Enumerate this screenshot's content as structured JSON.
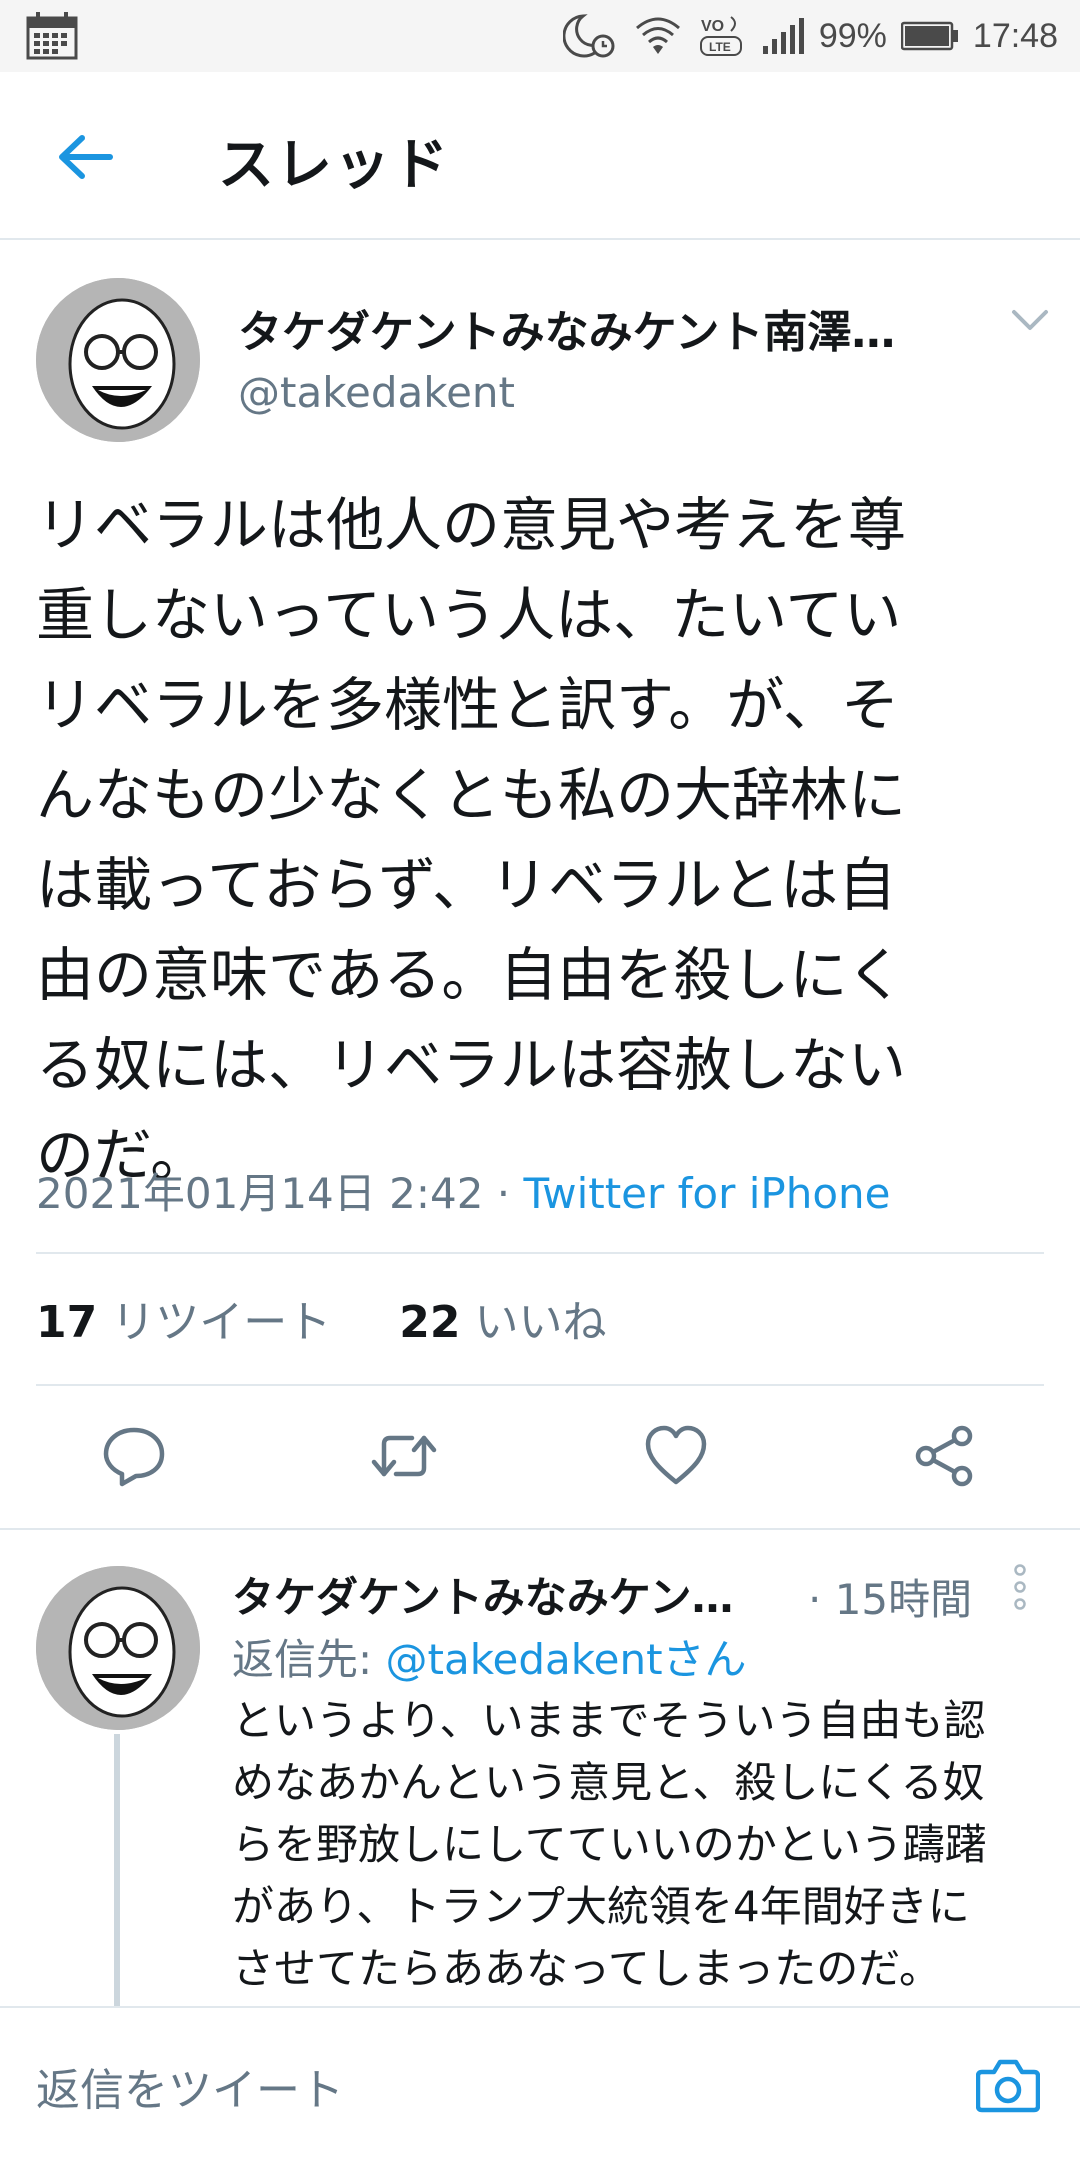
{
  "status_bar": {
    "battery_percent": "99%",
    "time": "17:48",
    "volte_label": "VoLTE",
    "icons": [
      "calendar-icon",
      "alarm-moon-icon",
      "wifi-icon",
      "volte-icon",
      "signal-icon",
      "battery-icon"
    ]
  },
  "header": {
    "title": "スレッド",
    "back_icon": "arrow-left-icon"
  },
  "main_tweet": {
    "author_name": "タケダケントみなみケント南澤径…",
    "handle": "@takedakent",
    "text": "リベラルは他人の意見や考えを尊\n重しないっていう人は、たいてい\nリベラルを多様性と訳す。が、そ\nんなもの少なくとも私の大辞林に\nは載っておらず、リベラルとは自\n由の意味である。自由を殺しにく\nる奴には、リベラルは容赦しない\nのだ。",
    "timestamp": "2021年01月14日 2:42",
    "separator": " · ",
    "source": "Twitter for iPhone",
    "retweet_count": "17",
    "retweet_label": "リツイート",
    "like_count": "22",
    "like_label": "いいね"
  },
  "reply_tweet": {
    "author_name": "タケダケントみなみケン…",
    "time": "· 15時間",
    "reply_to_prefix": "返信先: ",
    "reply_to_handle": "@takedakentさん",
    "text": "というより、いままでそういう自由も認\nめなあかんという意見と、殺しにくる奴\nらを野放しにしてていいのかという躊躇\nがあり、トランプ大統領を4年間好きに\nさせてたらああなってしまったのだ。"
  },
  "composer": {
    "placeholder": "返信をツイート",
    "camera_icon": "camera-icon"
  },
  "colors": {
    "accent": "#1b95e0",
    "text": "#14171a",
    "muted": "#657786",
    "divider": "#e1e8ed",
    "status_bar_bg": "#f5f5f5"
  }
}
